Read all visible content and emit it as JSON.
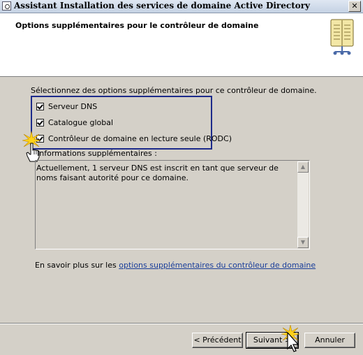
{
  "window": {
    "title": "Assistant Installation des services de domaine Active Directory",
    "close_label": "✕"
  },
  "header": {
    "heading": "Options supplémentaires pour le contrôleur de domaine"
  },
  "main": {
    "intro": "Sélectionnez des options supplémentaires pour ce contrôleur de domaine.",
    "options": [
      {
        "label": "Serveur DNS",
        "checked": true
      },
      {
        "label": "Catalogue global",
        "checked": true
      },
      {
        "label": "Contrôleur de domaine en lecture seule (RODC)",
        "checked": true
      }
    ],
    "info_label": "Informations supplémentaires :",
    "info_text": "Actuellement, 1 serveur DNS est inscrit en tant que serveur de noms faisant autorité pour ce domaine.",
    "learn_more_prefix": "En savoir plus sur les",
    "learn_more_link": "options supplémentaires du contrôleur de domaine"
  },
  "footer": {
    "back_label": "< Précédent",
    "next_label": "Suivant >",
    "cancel_label": "Annuler"
  }
}
